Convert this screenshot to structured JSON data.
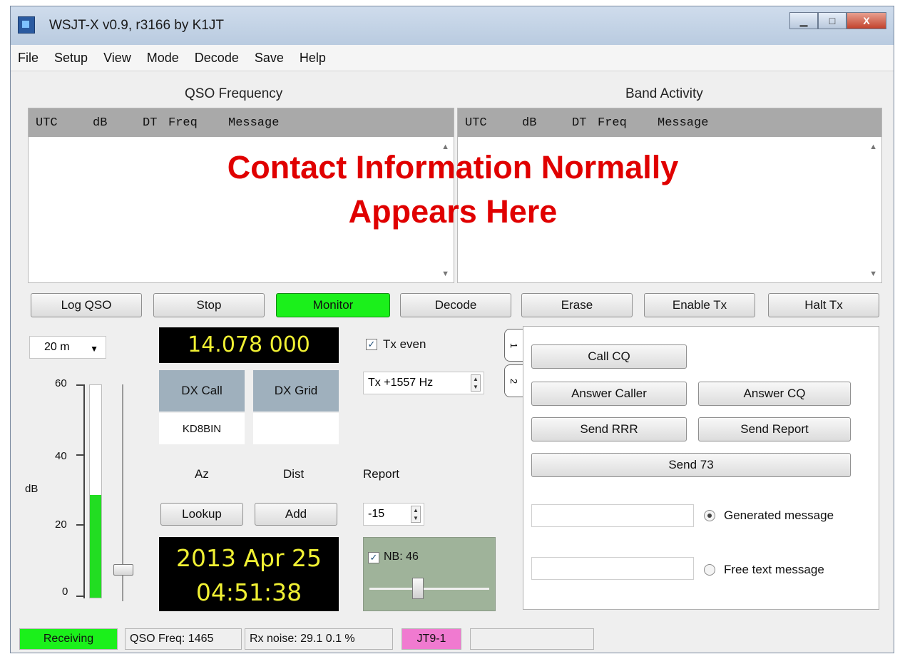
{
  "window": {
    "title": "WSJT-X   v0.9, r3166    by K1JT",
    "controls": {
      "minimize": "▁",
      "maximize": "□",
      "close": "X"
    }
  },
  "menu": [
    "File",
    "Setup",
    "View",
    "Mode",
    "Decode",
    "Save",
    "Help"
  ],
  "qso_panel": {
    "title": "QSO Frequency",
    "columns": [
      "UTC",
      "dB",
      "DT",
      "Freq",
      "Message"
    ]
  },
  "band_panel": {
    "title": "Band Activity",
    "columns": [
      "UTC",
      "dB",
      "DT",
      "Freq",
      "Message"
    ]
  },
  "overlay": {
    "line1": "Contact Information Normally",
    "line2": "Appears Here"
  },
  "buttons": {
    "log_qso": "Log QSO",
    "stop": "Stop",
    "monitor": "Monitor",
    "decode": "Decode",
    "erase": "Erase",
    "enable_tx": "Enable Tx",
    "halt_tx": "Halt Tx"
  },
  "band": {
    "selected": "20 m"
  },
  "meter": {
    "axis_label": "dB",
    "ticks": [
      "60",
      "40",
      "20",
      "0"
    ],
    "level_db": 29,
    "max_db": 60
  },
  "frequency_display": "14.078 000",
  "dx": {
    "call_label": "DX Call",
    "grid_label": "DX Grid",
    "call_value": "KD8BIN",
    "grid_value": ""
  },
  "az_label": "Az",
  "dist_label": "Dist",
  "lookup_button": "Lookup",
  "add_button": "Add",
  "clock": {
    "date": "2013 Apr 25",
    "time": "04:51:38"
  },
  "tx_even": {
    "label": "Tx even",
    "checked": true
  },
  "tx_freq": "Tx +1557  Hz",
  "report": {
    "label": "Report",
    "value": "-15"
  },
  "nb": {
    "label": "NB: 46",
    "checked": true
  },
  "tabs": [
    "1",
    "2"
  ],
  "tab_buttons": {
    "call_cq": "Call CQ",
    "answer_caller": "Answer Caller",
    "answer_cq": "Answer CQ",
    "send_rrr": "Send RRR",
    "send_report": "Send Report",
    "send_73": "Send 73"
  },
  "message_options": {
    "generated": "Generated message",
    "free_text": "Free text message",
    "selected": "generated"
  },
  "status": {
    "receiving": "Receiving",
    "qso_freq": "QSO Freq:  1465",
    "rx_noise": "Rx noise:  29.1    0.1 %",
    "mode": "JT9-1",
    "empty": ""
  },
  "colors": {
    "monitor_active": "#1bf01b",
    "receiving": "#1bf01b",
    "mode_badge": "#f07ad0",
    "overlay_text": "#e00000",
    "lcd_text": "#f0f033",
    "dx_header": "#9fb0bd"
  }
}
